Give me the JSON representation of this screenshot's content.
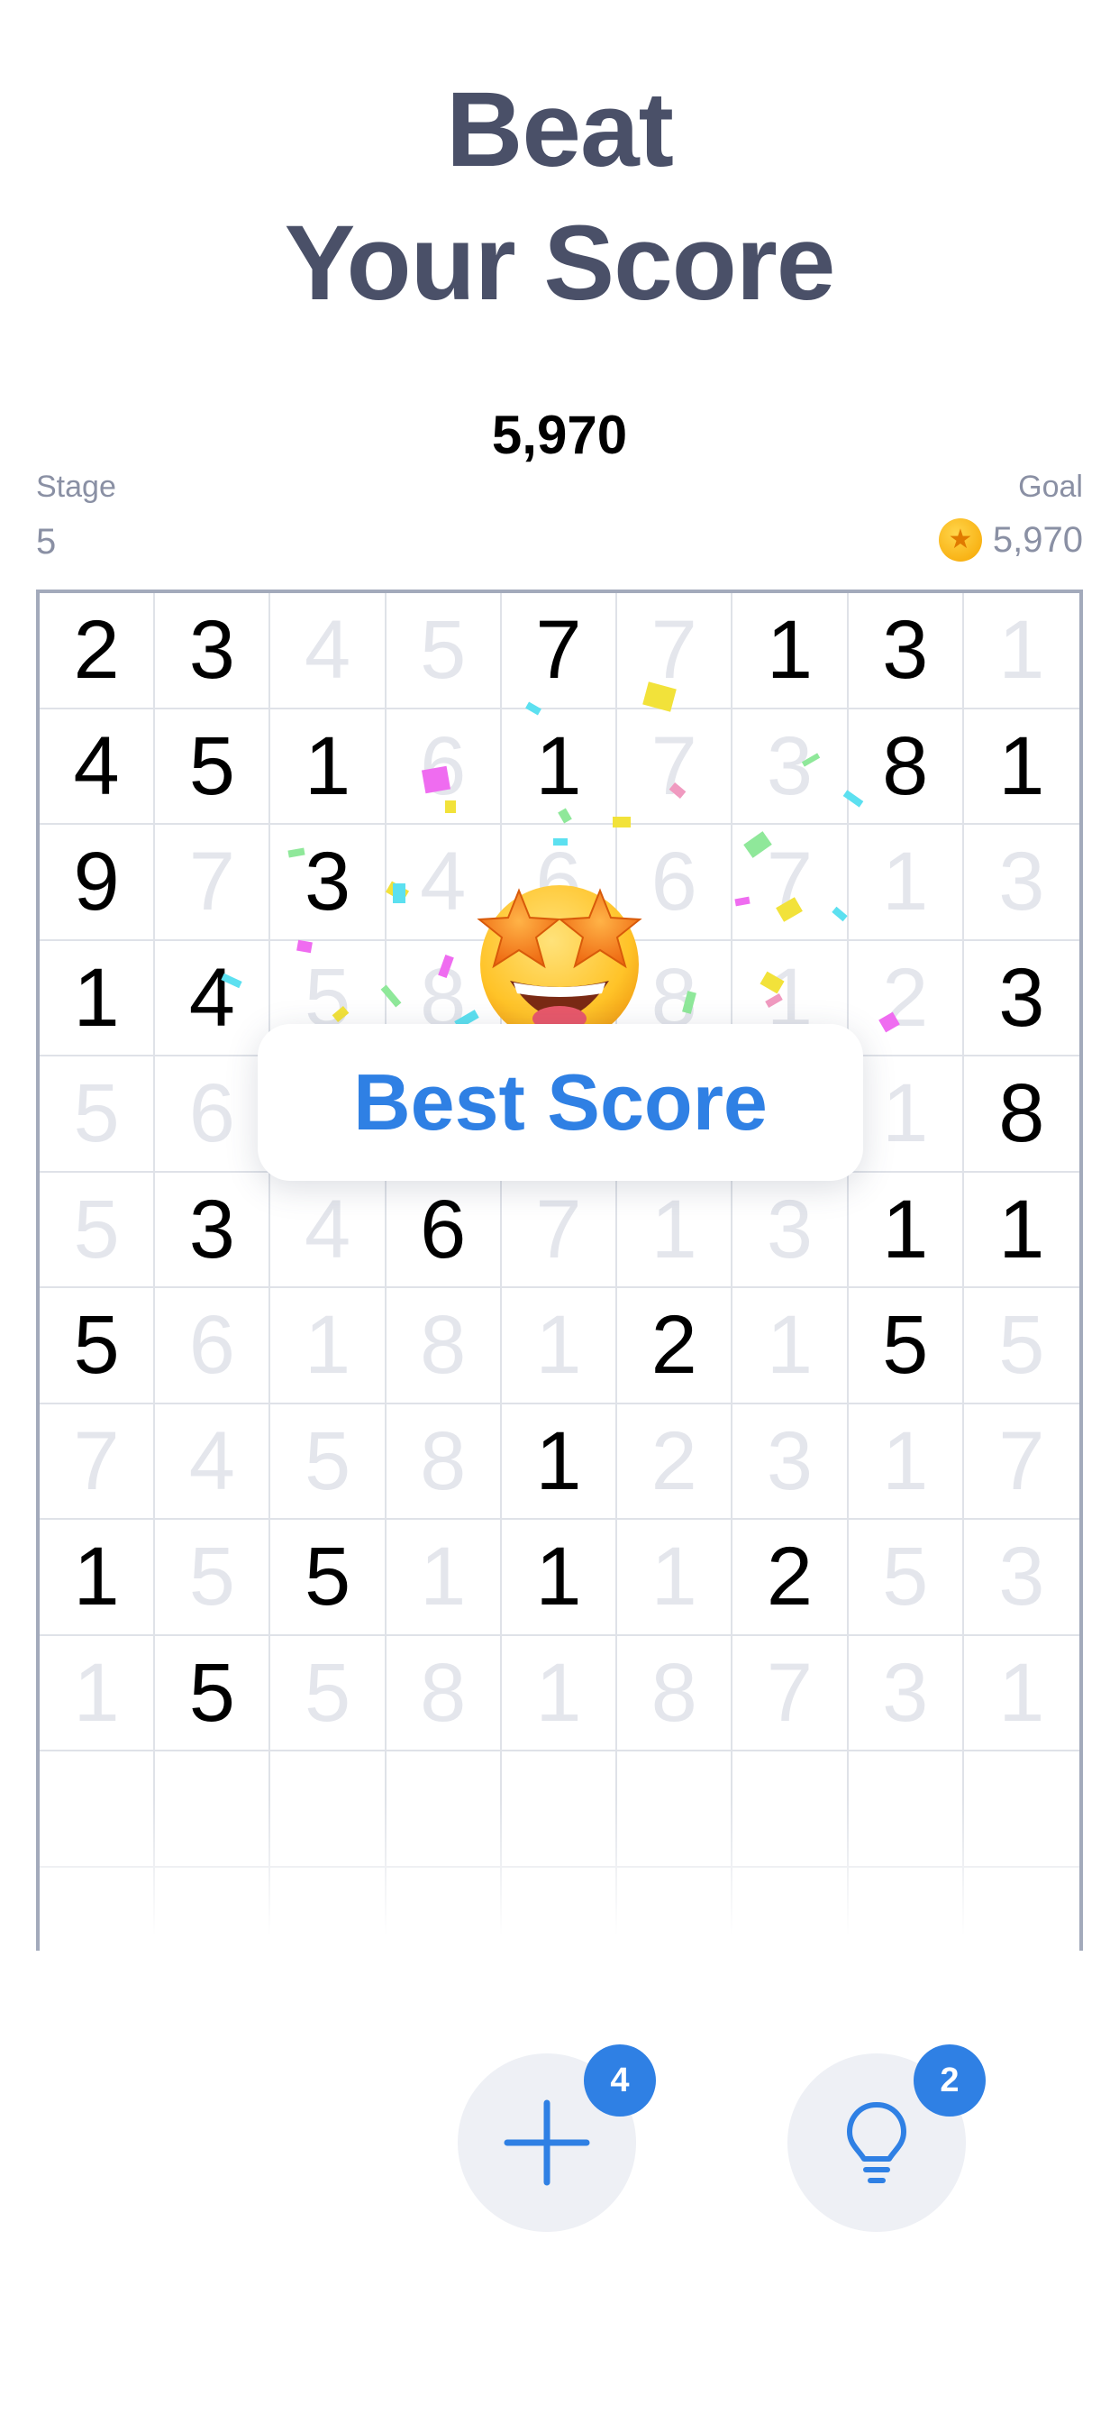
{
  "headline": {
    "line1": "Beat",
    "line2": "Your Score"
  },
  "score": "5,970",
  "stage": {
    "label": "Stage",
    "value": "5"
  },
  "goal": {
    "label": "Goal",
    "value": "5,970",
    "icon": "star-coin-icon"
  },
  "board": {
    "rows": [
      [
        [
          "2",
          true
        ],
        [
          "3",
          true
        ],
        [
          "4",
          false
        ],
        [
          "5",
          false
        ],
        [
          "7",
          true
        ],
        [
          "7",
          false
        ],
        [
          "1",
          true
        ],
        [
          "3",
          true
        ],
        [
          "1",
          false
        ]
      ],
      [
        [
          "4",
          true
        ],
        [
          "5",
          true
        ],
        [
          "1",
          true
        ],
        [
          "6",
          false
        ],
        [
          "1",
          true
        ],
        [
          "7",
          false
        ],
        [
          "3",
          false
        ],
        [
          "8",
          true
        ],
        [
          "1",
          true
        ]
      ],
      [
        [
          "9",
          true
        ],
        [
          "7",
          false
        ],
        [
          "3",
          true
        ],
        [
          "4",
          false
        ],
        [
          "6",
          false
        ],
        [
          "6",
          false
        ],
        [
          "7",
          false
        ],
        [
          "1",
          false
        ],
        [
          "3",
          false
        ]
      ],
      [
        [
          "1",
          true
        ],
        [
          "4",
          true
        ],
        [
          "5",
          false
        ],
        [
          "8",
          false
        ],
        [
          "",
          false
        ],
        [
          "8",
          false
        ],
        [
          "1",
          false
        ],
        [
          "2",
          false
        ],
        [
          "3",
          true
        ]
      ],
      [
        [
          "5",
          false
        ],
        [
          "6",
          false
        ],
        [
          "",
          false
        ],
        [
          "",
          false
        ],
        [
          "",
          false
        ],
        [
          "",
          false
        ],
        [
          "",
          false
        ],
        [
          "1",
          false
        ],
        [
          "8",
          true
        ]
      ],
      [
        [
          "5",
          false
        ],
        [
          "3",
          true
        ],
        [
          "4",
          false
        ],
        [
          "6",
          true
        ],
        [
          "7",
          false
        ],
        [
          "1",
          false
        ],
        [
          "3",
          false
        ],
        [
          "1",
          true
        ],
        [
          "1",
          true
        ]
      ],
      [
        [
          "5",
          true
        ],
        [
          "6",
          false
        ],
        [
          "1",
          false
        ],
        [
          "8",
          false
        ],
        [
          "1",
          false
        ],
        [
          "2",
          true
        ],
        [
          "1",
          false
        ],
        [
          "5",
          true
        ],
        [
          "5",
          false
        ]
      ],
      [
        [
          "7",
          false
        ],
        [
          "4",
          false
        ],
        [
          "5",
          false
        ],
        [
          "8",
          false
        ],
        [
          "1",
          true
        ],
        [
          "2",
          false
        ],
        [
          "3",
          false
        ],
        [
          "1",
          false
        ],
        [
          "7",
          false
        ]
      ],
      [
        [
          "1",
          true
        ],
        [
          "5",
          false
        ],
        [
          "5",
          true
        ],
        [
          "1",
          false
        ],
        [
          "1",
          true
        ],
        [
          "1",
          false
        ],
        [
          "2",
          true
        ],
        [
          "5",
          false
        ],
        [
          "3",
          false
        ]
      ],
      [
        [
          "1",
          false
        ],
        [
          "5",
          true
        ],
        [
          "5",
          false
        ],
        [
          "8",
          false
        ],
        [
          "1",
          false
        ],
        [
          "8",
          false
        ],
        [
          "7",
          false
        ],
        [
          "3",
          false
        ],
        [
          "1",
          false
        ]
      ],
      [
        [
          "",
          false
        ],
        [
          "",
          false
        ],
        [
          "",
          false
        ],
        [
          "",
          false
        ],
        [
          "",
          false
        ],
        [
          "",
          false
        ],
        [
          "",
          false
        ],
        [
          "",
          false
        ],
        [
          "",
          false
        ]
      ],
      [
        [
          "",
          false
        ],
        [
          "",
          false
        ],
        [
          "",
          false
        ],
        [
          "",
          false
        ],
        [
          "",
          false
        ],
        [
          "",
          false
        ],
        [
          "",
          false
        ],
        [
          "",
          false
        ],
        [
          "",
          false
        ]
      ]
    ]
  },
  "popup": {
    "text": "Best Score",
    "icon": "star-struck-emoji-icon"
  },
  "tools": {
    "add": {
      "icon": "plus-icon",
      "badge": "4"
    },
    "hint": {
      "icon": "lightbulb-icon",
      "badge": "2"
    }
  },
  "colors": {
    "accent": "#2f80e4",
    "title": "#4a5068",
    "muted": "#8a90a4",
    "dim_digit": "#e4e6ec",
    "grid_line": "#dfe2e8"
  }
}
